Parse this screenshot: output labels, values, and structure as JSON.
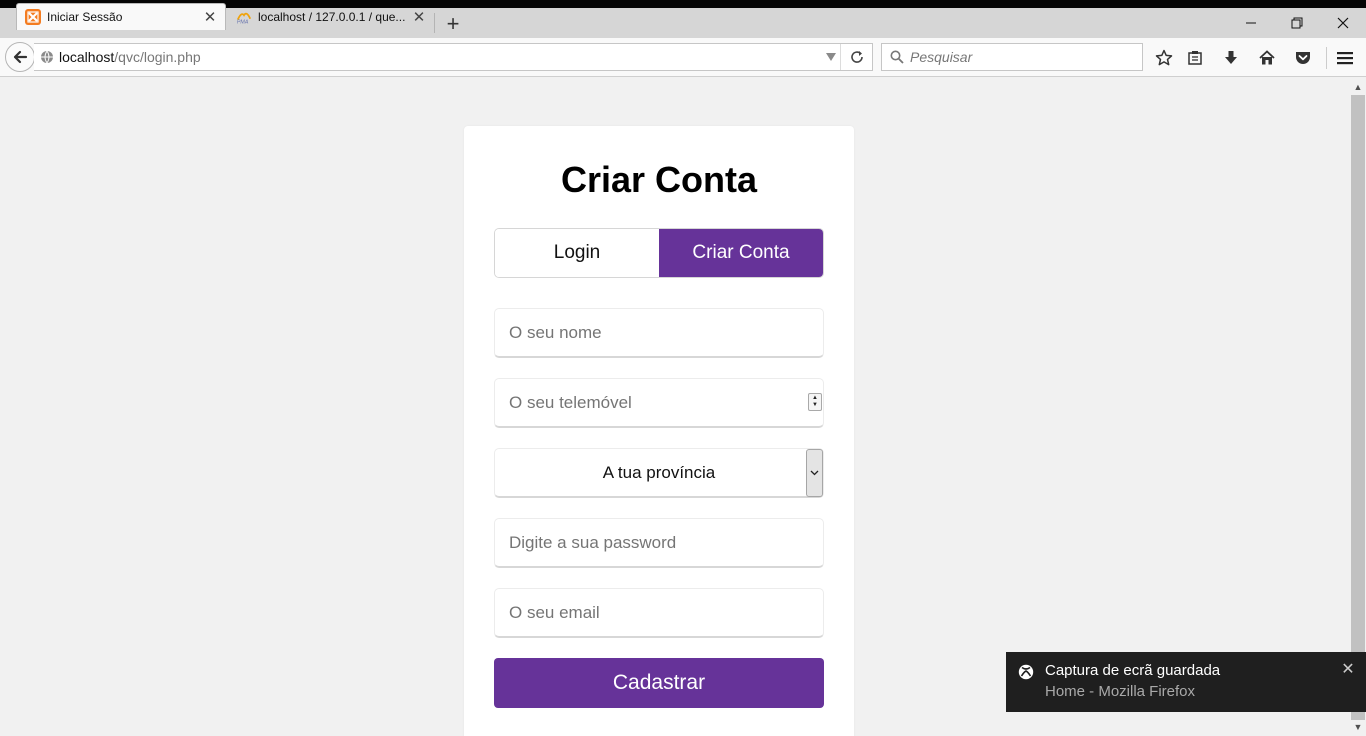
{
  "browser": {
    "tabs": [
      {
        "title": "Iniciar Sessão",
        "favicon": "xampp-icon",
        "active": true
      },
      {
        "title": "localhost / 127.0.0.1 / que...",
        "favicon": "phpmyadmin-icon",
        "active": false
      }
    ],
    "url": {
      "host": "localhost",
      "path": "/qvc/login.php"
    },
    "search_placeholder": "Pesquisar"
  },
  "card": {
    "title": "Criar Conta",
    "switch": {
      "login_label": "Login",
      "signup_label": "Criar Conta",
      "active": "signup"
    },
    "fields": {
      "name_placeholder": "O seu nome",
      "phone_placeholder": "O seu telemóvel",
      "province_selected": "A tua província",
      "password_placeholder": "Digite a sua password",
      "email_placeholder": "O seu email"
    },
    "submit_label": "Cadastrar",
    "accent_color": "#663399"
  },
  "toast": {
    "title": "Captura de ecrã guardada",
    "subtitle": "Home - Mozilla Firefox"
  }
}
